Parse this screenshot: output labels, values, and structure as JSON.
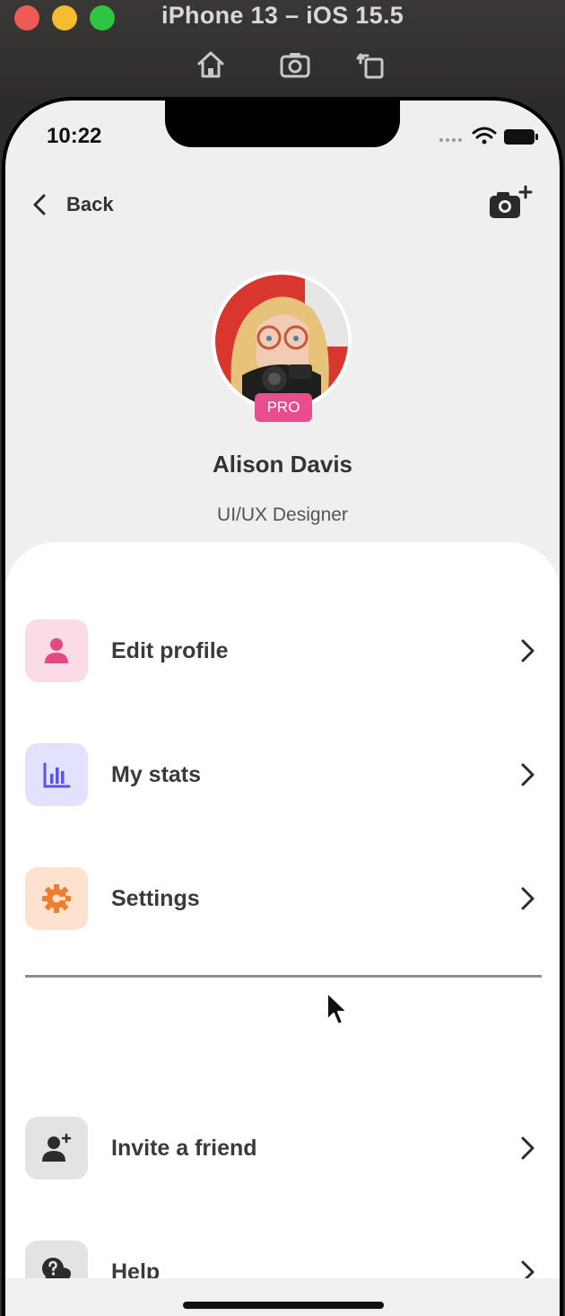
{
  "window": {
    "title": "iPhone 13 – iOS 15.5"
  },
  "toolbar": {
    "icons": [
      "home-icon",
      "screenshot-icon",
      "rotate-icon"
    ]
  },
  "status_bar": {
    "time": "10:22"
  },
  "nav": {
    "back_label": "Back",
    "right_icon": "camera-add-icon"
  },
  "profile": {
    "badge": "PRO",
    "name": "Alison Davis",
    "role": "UI/UX Designer"
  },
  "menu": [
    {
      "label": "Edit profile",
      "icon": "person-icon",
      "bg": "#fbdce6",
      "fg": "#e24a84"
    },
    {
      "label": "My stats",
      "icon": "bar-chart-icon",
      "bg": "#e3e2fd",
      "fg": "#5b56e0"
    },
    {
      "label": "Settings",
      "icon": "gear-icon",
      "bg": "#fde2cf",
      "fg": "#ee7d2e"
    },
    {
      "label": "Invite a friend",
      "icon": "add-user-icon",
      "bg": "#e3e3e3",
      "fg": "#2c2c2c"
    },
    {
      "label": "Help",
      "icon": "help-chat-icon",
      "bg": "#e3e3e3",
      "fg": "#2c2c2c"
    }
  ],
  "colors": {
    "pro_badge": "#e94d8e",
    "screen_bg": "#efefef",
    "sheet_bg": "#ffffff"
  }
}
